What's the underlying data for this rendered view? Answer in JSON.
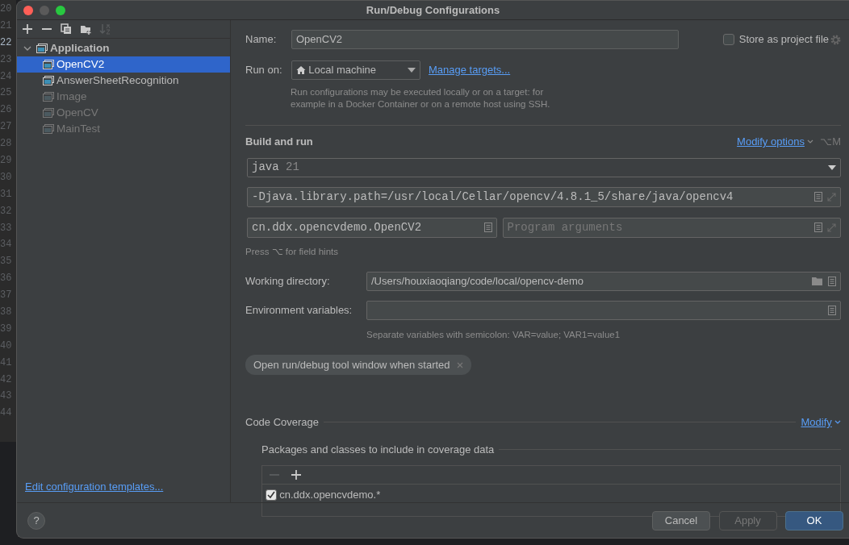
{
  "editor_gutter": [
    {
      "number": "20",
      "current": false
    },
    {
      "number": "21",
      "current": false
    },
    {
      "number": "22",
      "current": true
    },
    {
      "number": "23",
      "current": false
    },
    {
      "number": "24",
      "current": false
    },
    {
      "number": "25",
      "current": false
    },
    {
      "number": "26",
      "current": false
    },
    {
      "number": "27",
      "current": false
    },
    {
      "number": "28",
      "current": false
    },
    {
      "number": "29",
      "current": false
    },
    {
      "number": "30",
      "current": false
    },
    {
      "number": "31",
      "current": false
    },
    {
      "number": "32",
      "current": false
    },
    {
      "number": "33",
      "current": false
    },
    {
      "number": "34",
      "current": false
    },
    {
      "number": "35",
      "current": false
    },
    {
      "number": "36",
      "current": false
    },
    {
      "number": "37",
      "current": false
    },
    {
      "number": "38",
      "current": false
    },
    {
      "number": "39",
      "current": false
    },
    {
      "number": "40",
      "current": false
    },
    {
      "number": "41",
      "current": false
    },
    {
      "number": "42",
      "current": false
    },
    {
      "number": "43",
      "current": false
    },
    {
      "number": "44",
      "current": false
    }
  ],
  "window": {
    "title": "Run/Debug Configurations"
  },
  "sidebar_toolbar": [
    {
      "kind": "add",
      "disabled": false
    },
    {
      "kind": "remove",
      "disabled": false
    },
    {
      "kind": "copy",
      "disabled": false
    },
    {
      "kind": "folder",
      "disabled": false
    },
    {
      "kind": "sort",
      "disabled": true
    }
  ],
  "tree": [
    {
      "label": "Application",
      "expanded": true,
      "selected": false,
      "dimmed": false,
      "children": [
        {
          "label": "OpenCV2",
          "selected": true,
          "dimmed": false
        },
        {
          "label": "AnswerSheetRecognition",
          "selected": false,
          "dimmed": false
        },
        {
          "label": "Image",
          "selected": false,
          "dimmed": true
        },
        {
          "label": "OpenCV",
          "selected": false,
          "dimmed": true
        },
        {
          "label": "MainTest",
          "selected": false,
          "dimmed": true
        }
      ]
    }
  ],
  "templates_link": "Edit configuration templates...",
  "name_field": {
    "label": "Name:",
    "value": "OpenCV2"
  },
  "store_as_project_file": {
    "label": "Store as project file",
    "checked": false
  },
  "run_on": {
    "label": "Run on:",
    "value": "Local machine",
    "link": "Manage targets...",
    "hint": "Run configurations may be executed locally or on a target: for example in a Docker Container or on a remote host using SSH."
  },
  "build_and_run": {
    "title": "Build and run",
    "modify_options": "Modify options",
    "shortcut": "⌥M",
    "jdk": {
      "value": "java",
      "version": "21"
    },
    "vm_options": {
      "value": "-Djava.library.path=/usr/local/Cellar/opencv/4.8.1_5/share/java/opencv4"
    },
    "main_class": {
      "value": "cn.ddx.opencvdemo.OpenCV2"
    },
    "program_arguments": {
      "placeholder": "Program arguments"
    },
    "field_hint": "Press ⌥ for field hints"
  },
  "working_directory": {
    "label": "Working directory:",
    "value": "/Users/houxiaoqiang/code/local/opencv-demo"
  },
  "environment_variables": {
    "label": "Environment variables:",
    "hint": "Separate variables with semicolon: VAR=value; VAR1=value1"
  },
  "option_chips": [
    {
      "label": "Open run/debug tool window when started"
    }
  ],
  "code_coverage": {
    "title": "Code Coverage",
    "modify": "Modify",
    "packages_title": "Packages and classes to include in coverage data",
    "toolbar": [
      {
        "kind": "remove",
        "disabled": true
      },
      {
        "kind": "add",
        "disabled": false
      }
    ],
    "patterns": [
      {
        "label": "cn.ddx.opencvdemo.*",
        "checked": true
      }
    ]
  },
  "footer": {
    "help": "?",
    "buttons": [
      {
        "label": "Cancel",
        "kind": "default",
        "disabled": false
      },
      {
        "label": "Apply",
        "kind": "default",
        "disabled": true
      },
      {
        "label": "OK",
        "kind": "primary",
        "disabled": false
      }
    ]
  }
}
